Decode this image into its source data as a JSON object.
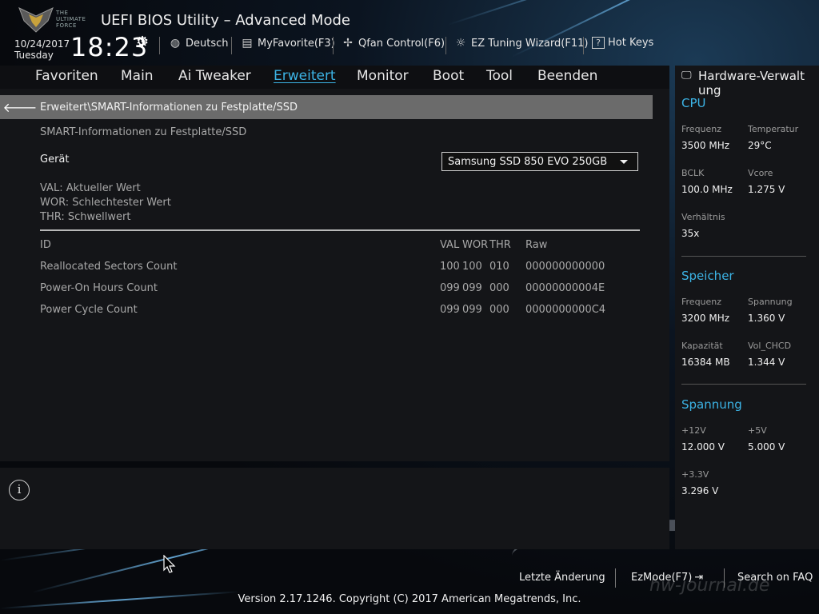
{
  "header": {
    "logo_text": "THE ULTIMATE FORCE",
    "title": "UEFI BIOS Utility – Advanced Mode",
    "date": "10/24/2017",
    "weekday": "Tuesday",
    "time": "18:23",
    "items": [
      {
        "label": "Deutsch",
        "icon": "globe-icon"
      },
      {
        "label": "MyFavorite(F3)",
        "icon": "favorite-icon"
      },
      {
        "label": "Qfan Control(F6)",
        "icon": "fan-icon"
      },
      {
        "label": "EZ Tuning Wizard(F11)",
        "icon": "lightbulb-icon"
      },
      {
        "label": "Hot Keys",
        "icon": "question-icon"
      }
    ]
  },
  "menu": {
    "tabs": [
      "Favoriten",
      "Main",
      "Ai Tweaker",
      "Erweitert",
      "Monitor",
      "Boot",
      "Tool",
      "Beenden"
    ],
    "active": "Erweitert"
  },
  "main": {
    "breadcrumb": "Erweitert\\SMART-Informationen zu Festplatte/SSD",
    "section_title": "SMART-Informationen zu Festplatte/SSD",
    "device_label": "Gerät",
    "device_value": "Samsung SSD 850 EVO 250GB",
    "legend": [
      "VAL: Aktueller Wert",
      "WOR: Schlechtester Wert",
      "THR: Schwellwert"
    ],
    "table": {
      "headers": {
        "id": "ID",
        "val": "VAL",
        "wor": "WOR",
        "thr": "THR",
        "raw": "Raw"
      },
      "rows": [
        {
          "id": "Reallocated Sectors Count",
          "val": "100",
          "wor": "100",
          "thr": "010",
          "raw": "000000000000"
        },
        {
          "id": "Power-On Hours Count",
          "val": "099",
          "wor": "099",
          "thr": "000",
          "raw": "00000000004E"
        },
        {
          "id": "Power Cycle Count",
          "val": "099",
          "wor": "099",
          "thr": "000",
          "raw": "0000000000C4"
        }
      ]
    }
  },
  "hardware": {
    "title": "Hardware-Verwaltung",
    "sections": [
      {
        "name": "CPU",
        "fields": [
          {
            "label": "Frequenz",
            "value": "3500 MHz"
          },
          {
            "label": "Temperatur",
            "value": "29°C"
          },
          {
            "label": "BCLK",
            "value": "100.0 MHz"
          },
          {
            "label": "Vcore",
            "value": "1.275 V"
          },
          {
            "label": "Verhältnis",
            "value": "35x"
          }
        ]
      },
      {
        "name": "Speicher",
        "fields": [
          {
            "label": "Frequenz",
            "value": "3200 MHz"
          },
          {
            "label": "Spannung",
            "value": "1.360 V"
          },
          {
            "label": "Kapazität",
            "value": "16384 MB"
          },
          {
            "label": "Vol_CHCD",
            "value": "1.344 V"
          }
        ]
      },
      {
        "name": "Spannung",
        "fields": [
          {
            "label": "+12V",
            "value": "12.000 V"
          },
          {
            "label": "+5V",
            "value": "5.000 V"
          },
          {
            "label": "+3.3V",
            "value": "3.296 V"
          }
        ]
      }
    ]
  },
  "footer": {
    "last_change": "Letzte Änderung",
    "ezmode": "EzMode(F7)",
    "faq": "Search on FAQ",
    "copyright": "Version 2.17.1246. Copyright (C) 2017 American Megatrends, Inc.",
    "watermark": "hw-journal.de"
  },
  "colors": {
    "accent": "#3cb4e6",
    "breadcrumb_bg": "#6b6b6b",
    "panel_bg": "#141518"
  }
}
